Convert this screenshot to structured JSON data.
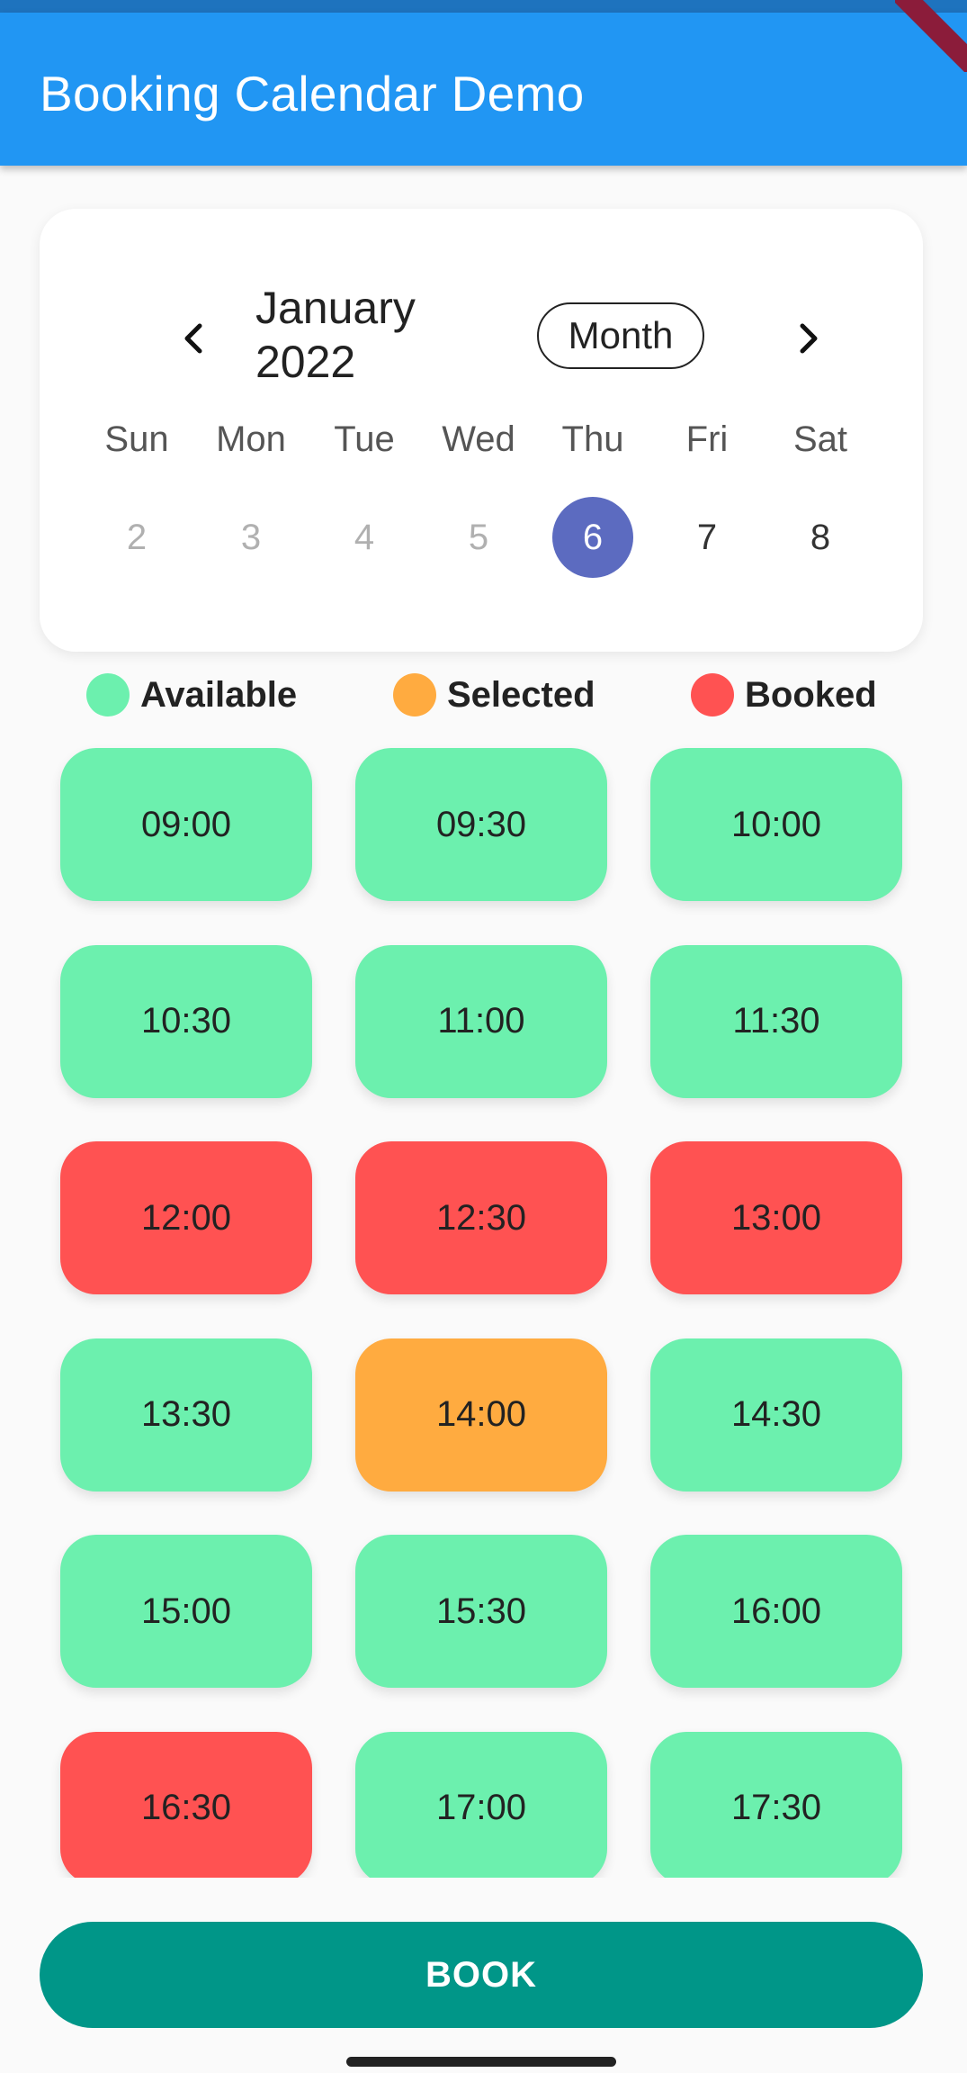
{
  "app_bar": {
    "title": "Booking Calendar Demo"
  },
  "calendar": {
    "month_title": "January 2022",
    "format_button": "Month",
    "weekdays": [
      "Sun",
      "Mon",
      "Tue",
      "Wed",
      "Thu",
      "Fri",
      "Sat"
    ],
    "days": [
      {
        "label": "2",
        "state": "past"
      },
      {
        "label": "3",
        "state": "past"
      },
      {
        "label": "4",
        "state": "past"
      },
      {
        "label": "5",
        "state": "past"
      },
      {
        "label": "6",
        "state": "selected"
      },
      {
        "label": "7",
        "state": "future"
      },
      {
        "label": "8",
        "state": "future"
      }
    ],
    "icons": {
      "prev": "chevron-left-icon",
      "next": "chevron-right-icon"
    }
  },
  "legend": [
    {
      "label": "Available",
      "color": "#6cf0ae"
    },
    {
      "label": "Selected",
      "color": "#ffab40"
    },
    {
      "label": "Booked",
      "color": "#ff5252"
    }
  ],
  "slots": [
    {
      "time": "09:00",
      "status": "available"
    },
    {
      "time": "09:30",
      "status": "available"
    },
    {
      "time": "10:00",
      "status": "available"
    },
    {
      "time": "10:30",
      "status": "available"
    },
    {
      "time": "11:00",
      "status": "available"
    },
    {
      "time": "11:30",
      "status": "available"
    },
    {
      "time": "12:00",
      "status": "booked"
    },
    {
      "time": "12:30",
      "status": "booked"
    },
    {
      "time": "13:00",
      "status": "booked"
    },
    {
      "time": "13:30",
      "status": "available"
    },
    {
      "time": "14:00",
      "status": "selected"
    },
    {
      "time": "14:30",
      "status": "available"
    },
    {
      "time": "15:00",
      "status": "available"
    },
    {
      "time": "15:30",
      "status": "available"
    },
    {
      "time": "16:00",
      "status": "available"
    },
    {
      "time": "16:30",
      "status": "booked"
    },
    {
      "time": "17:00",
      "status": "available"
    },
    {
      "time": "17:30",
      "status": "available"
    }
  ],
  "status_colors": {
    "available": "#6cf0ae",
    "selected": "#ffab40",
    "booked": "#ff5252"
  },
  "book_button": {
    "label": "BOOK"
  }
}
